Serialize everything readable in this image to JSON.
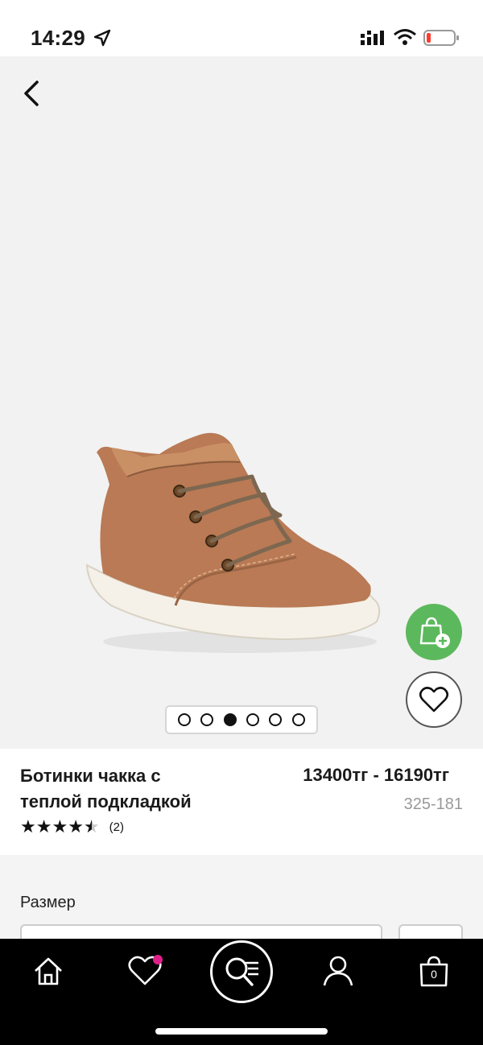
{
  "status_bar": {
    "time": "14:29",
    "icons": [
      "location-arrow-icon",
      "cellular-signal-icon",
      "wifi-icon",
      "battery-low-icon"
    ]
  },
  "gallery": {
    "image": "brown-leather-chukka-boot",
    "pages": 6,
    "active_page": 3
  },
  "product": {
    "title": "Ботинки чакка с\nтеплой подкладкой",
    "price": "13400тг - 16190тг",
    "sku": "325-181",
    "rating": 4.5,
    "review_count": "(2)"
  },
  "size": {
    "label": "Размер"
  },
  "tab_bar": {
    "items": [
      "home-icon",
      "wishlist-icon",
      "search-icon",
      "account-icon",
      "bag-icon"
    ],
    "bag_count": "0"
  },
  "colors": {
    "add_to_bag": "#5cb85c",
    "badge": "#e0208a",
    "gallery_bg": "#f2f2f2"
  }
}
